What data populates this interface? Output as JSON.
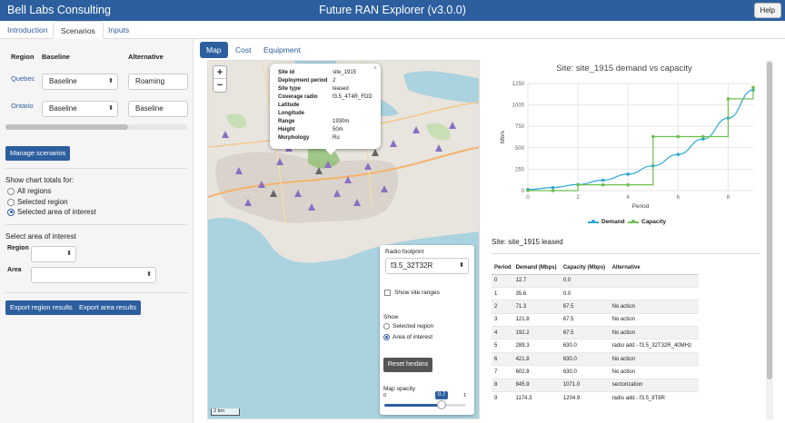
{
  "header": {
    "brand": "Bell Labs Consulting",
    "title": "Future RAN Explorer (v3.0.0)",
    "help_label": "Help",
    "bar_color": "#2d5f9f"
  },
  "main_tabs": [
    {
      "label": "Introduction",
      "active": false
    },
    {
      "label": "Scenarios",
      "active": true
    },
    {
      "label": "Inputs",
      "active": false
    }
  ],
  "sidebar": {
    "col_region": "Region",
    "col_baseline": "Baseline",
    "col_alternative": "Alternative",
    "rows": [
      {
        "region": "Quebec",
        "baseline": "Baseline",
        "alternative": "Roaming"
      },
      {
        "region": "Ontario",
        "baseline": "Baseline",
        "alternative": "Baseline"
      }
    ],
    "manage_button": "Manage scenarios",
    "chart_totals_label": "Show chart totals for:",
    "chart_totals_options": [
      {
        "label": "All regions",
        "selected": false
      },
      {
        "label": "Selected region",
        "selected": false
      },
      {
        "label": "Selected area of interest",
        "selected": true
      }
    ],
    "aoi_title": "Select area of interest",
    "aoi_region_label": "Region",
    "aoi_region_value": "",
    "aoi_area_label": "Area",
    "aoi_area_value": "",
    "export_region_button": "Export region results",
    "export_area_button": "Export area results"
  },
  "content_tabs": [
    {
      "label": "Map",
      "active": true
    },
    {
      "label": "Cost",
      "active": false
    },
    {
      "label": "Equipment",
      "active": false
    }
  ],
  "map": {
    "zoom_in": "+",
    "zoom_out": "−",
    "scale_label": "2 km",
    "popup": {
      "close": "×",
      "fields": [
        {
          "key": "Site id",
          "value": "site_1915"
        },
        {
          "key": "Deployment period",
          "value": "2"
        },
        {
          "key": "Site type",
          "value": "leased"
        },
        {
          "key": "Coverage radio",
          "value": "f3.5_4T4R_FDD"
        },
        {
          "key": "Latitude",
          "value": ""
        },
        {
          "key": "Longitude",
          "value": ""
        },
        {
          "key": "Range",
          "value": "1930m"
        },
        {
          "key": "Height",
          "value": "50m"
        },
        {
          "key": "Morphology",
          "value": "Ru"
        }
      ]
    },
    "controls": {
      "radio_footprint_label": "Radio footprint",
      "radio_footprint_value": "f3.5_32T32R",
      "show_site_ranges_label": "Show site ranges",
      "show_site_ranges_checked": false,
      "show_label": "Show",
      "show_options": [
        {
          "label": "Selected region",
          "selected": false
        },
        {
          "label": "Area of interest",
          "selected": true
        }
      ],
      "reset_button": "Reset hexbins",
      "opacity_label": "Map opacity",
      "opacity_min": "0",
      "opacity_max": "1",
      "opacity_value": "0.7"
    }
  },
  "chart_data": {
    "type": "line",
    "title": "Site: site_1915 demand vs capacity",
    "xlabel": "Period",
    "ylabel": "Mb/s",
    "xlim": [
      0,
      9
    ],
    "ylim": [
      0,
      1250
    ],
    "xticks": [
      0,
      2,
      4,
      6,
      8
    ],
    "yticks": [
      0,
      250,
      500,
      750,
      1000,
      1250
    ],
    "grid": true,
    "legend_position": "bottom",
    "x": [
      0,
      1,
      2,
      3,
      4,
      5,
      6,
      7,
      8,
      9
    ],
    "series": [
      {
        "name": "Demand",
        "color": "#2ca6d4",
        "values": [
          12.7,
          35.6,
          71.3,
          121.8,
          192.2,
          289.3,
          421.8,
          602.8,
          845.9,
          1174.3
        ],
        "step": false
      },
      {
        "name": "Capacity",
        "color": "#6dbf4e",
        "values": [
          0.0,
          0.0,
          67.5,
          67.5,
          67.5,
          630.0,
          630.0,
          630.0,
          1071.0,
          1204.9
        ],
        "step": true
      }
    ]
  },
  "site_status": "Site: site_1915 leased",
  "table": {
    "headers": [
      "Period",
      "Demand (Mbps)",
      "Capacity (Mbps)",
      "Alternative"
    ],
    "rows": [
      [
        "0",
        "12.7",
        "0.0",
        ""
      ],
      [
        "1",
        "35.6",
        "0.0",
        ""
      ],
      [
        "2",
        "71.3",
        "67.5",
        "No action"
      ],
      [
        "3",
        "121.8",
        "67.5",
        "No action"
      ],
      [
        "4",
        "192.2",
        "67.5",
        "No action"
      ],
      [
        "5",
        "289.3",
        "630.0",
        "radio add - f3.5_32T32R_40MHz"
      ],
      [
        "6",
        "421.8",
        "630.0",
        "No action"
      ],
      [
        "7",
        "602.8",
        "630.0",
        "No action"
      ],
      [
        "8",
        "845.9",
        "1071.0",
        "sectorization"
      ],
      [
        "9",
        "1174.3",
        "1204.9",
        "radio add - f3.5_8T8R"
      ]
    ]
  }
}
